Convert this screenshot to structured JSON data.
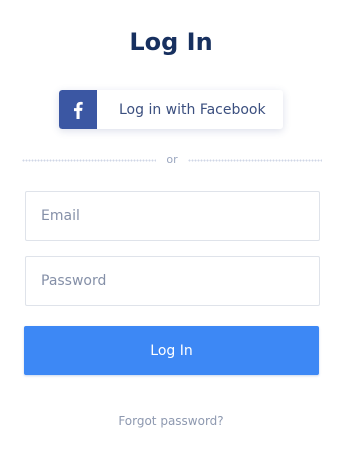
{
  "login": {
    "title": "Log In",
    "facebook_button_label": "Log in with Facebook",
    "facebook_icon_glyph": "f",
    "divider_text": "or",
    "email_placeholder": "Email",
    "email_value": "",
    "password_placeholder": "Password",
    "password_value": "",
    "submit_label": "Log In",
    "forgot_link": "Forgot password?"
  },
  "icons": {
    "facebook": "facebook-icon"
  },
  "colors": {
    "title": "#17305f",
    "facebook_brand": "#3b57a3",
    "primary_button": "#3d88f5",
    "link": "#8e99b0"
  }
}
